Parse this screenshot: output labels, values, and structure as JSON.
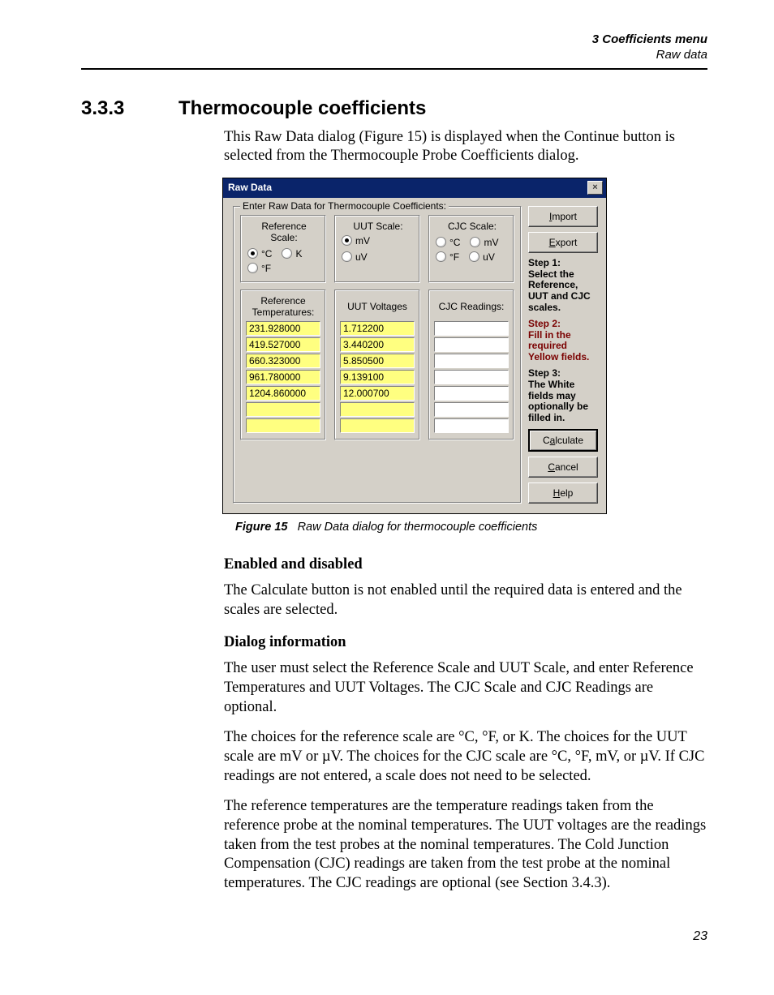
{
  "header": {
    "chapter": "3  Coefficients menu",
    "section": "Raw data"
  },
  "sec": {
    "num": "3.3.3",
    "title": "Thermocouple coefficients"
  },
  "intro": "This Raw Data dialog (Figure 15) is displayed when the Continue button is selected from the Thermocouple Probe Coefficients dialog.",
  "dialog": {
    "title": "Raw Data",
    "legend": "Enter Raw Data for Thermocouple Coefficients:",
    "ref": {
      "label": "Reference Scale:",
      "c": "°C",
      "k": "K",
      "f": "°F"
    },
    "uut": {
      "label": "UUT Scale:",
      "mv": "mV",
      "uv": "uV"
    },
    "cjc": {
      "label": "CJC Scale:",
      "c": "°C",
      "mv": "mV",
      "f": "°F",
      "uv": "uV"
    },
    "cols": {
      "ref": "Reference\nTemperatures:",
      "uut": "UUT Voltages",
      "cjc": "CJC Readings:"
    },
    "refvals": [
      "231.928000",
      "419.527000",
      "660.323000",
      "961.780000",
      "1204.860000",
      "",
      ""
    ],
    "uutvals": [
      "1.712200",
      "3.440200",
      "5.850500",
      "9.139100",
      "12.000700",
      "",
      ""
    ],
    "cjcvals": [
      "",
      "",
      "",
      "",
      "",
      "",
      ""
    ],
    "btn": {
      "import": "Import",
      "export": "Export",
      "calc": "Calculate",
      "cancel": "Cancel",
      "help": "Help"
    },
    "steps": {
      "s1": "Step 1:\nSelect the Reference, UUT and CJC scales.",
      "s2": "Step 2:\nFill in the required Yellow fields.",
      "s3": "Step 3:\nThe White fields may optionally be filled in."
    }
  },
  "figcap": {
    "b": "Figure 15",
    "i": "Raw Data dialog for thermocouple coefficients"
  },
  "h1": "Enabled and disabled",
  "p1": "The Calculate button is not enabled until the required data is entered and the scales are selected.",
  "h2": "Dialog information",
  "p2": "The user must select the Reference Scale and UUT Scale, and enter Reference Temperatures and UUT Voltages. The CJC Scale and CJC Readings are optional.",
  "p3": "The choices for the reference scale are °C, °F, or K. The choices for the UUT scale are mV or µV. The choices for the CJC scale are °C, °F, mV, or µV. If CJC readings are not entered, a scale does not need to be selected.",
  "p4": "The reference temperatures are the temperature readings taken from the reference probe at the nominal temperatures. The UUT voltages are the readings taken from the test probes at the nominal temperatures. The Cold Junction Compensation (CJC) readings are taken from the test probe at the nominal temperatures. The CJC readings are optional (see Section 3.4.3).",
  "pagenum": "23"
}
